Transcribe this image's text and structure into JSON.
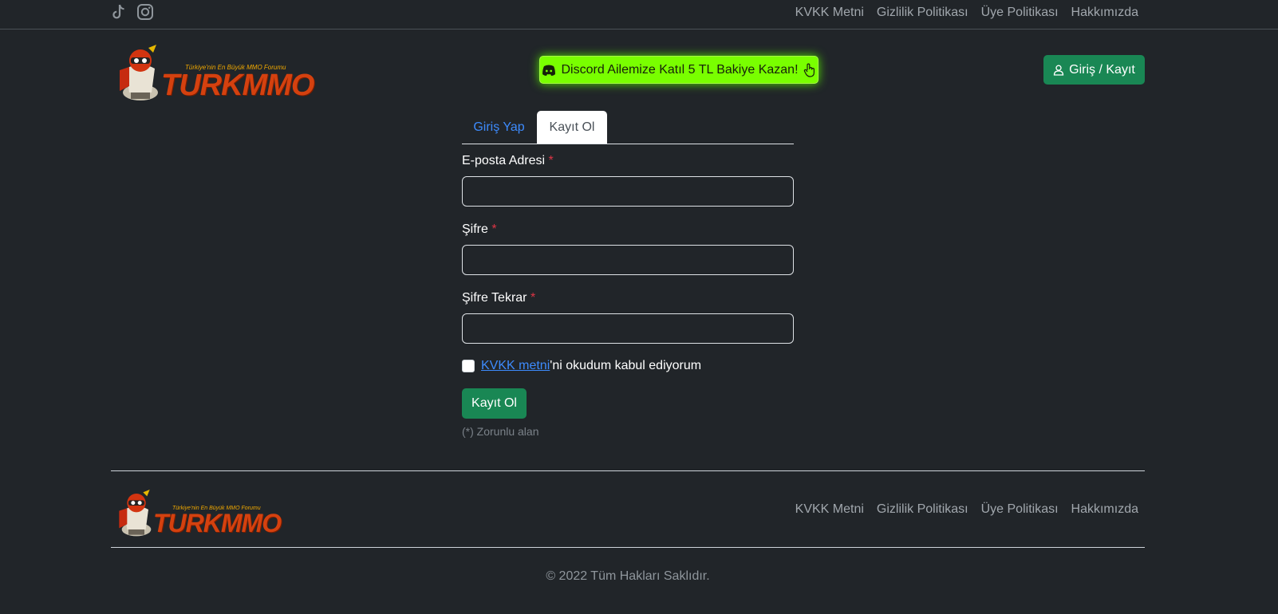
{
  "colors": {
    "bg": "#212529",
    "primary_green": "#198754",
    "discord_green": "#79ff00",
    "link_blue": "#3d8bfd",
    "required_red": "#dc3545"
  },
  "topbar": {
    "social_icons": [
      "tiktok-icon",
      "instagram-icon"
    ],
    "links": [
      "KVKK Metni",
      "Gizlilik Politikası",
      "Üye Politikası",
      "Hakkımızda"
    ]
  },
  "header": {
    "logo": {
      "word": "TURKMMO",
      "tagline": "Türkiye'nin En Büyük MMO Forumu"
    },
    "discord_button": "Discord Ailemize Katıl 5 TL Bakiye Kazan!",
    "login_button": "Giriş / Kayıt"
  },
  "tabs": [
    {
      "label": "Giriş Yap",
      "active": false
    },
    {
      "label": "Kayıt Ol",
      "active": true
    }
  ],
  "form": {
    "email_label": "E-posta Adresi",
    "email_value": "",
    "password_label": "Şifre",
    "password_value": "",
    "password_repeat_label": "Şifre Tekrar",
    "password_repeat_value": "",
    "required_marker": "*",
    "kvkk_link": "KVKK metni",
    "kvkk_suffix": "'ni okudum kabul ediyorum",
    "submit_label": "Kayıt Ol",
    "required_note": "(*) Zorunlu alan"
  },
  "footer": {
    "links": [
      "KVKK Metni",
      "Gizlilik Politikası",
      "Üye Politikası",
      "Hakkımızda"
    ],
    "copyright": "© 2022 Tüm Hakları Saklıdır."
  }
}
